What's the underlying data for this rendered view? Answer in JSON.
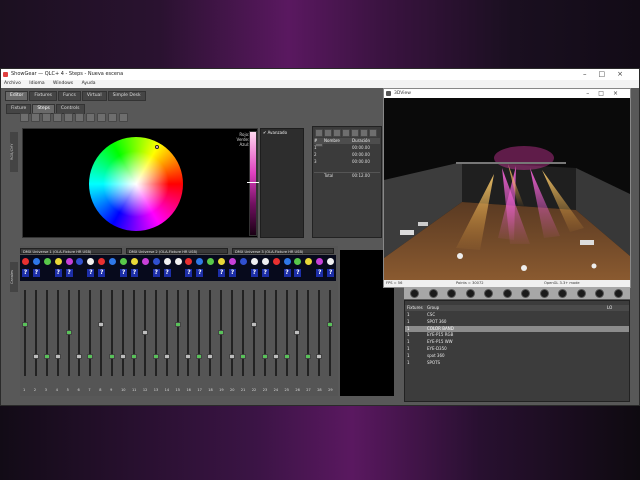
{
  "window": {
    "title": "ShowGear — QLC+ 4 - Steps - Nueva escena"
  },
  "menu": [
    "Archivo",
    "Idioma",
    "Windows",
    "Ayuda"
  ],
  "main_tabs": [
    "Editor",
    "Fixtures",
    "Funcs",
    "Virtual",
    "Simple Desk"
  ],
  "sub_tabs": [
    "Fixture",
    "Steps",
    "Controls"
  ],
  "color_picker": {
    "r": "Rojo:000",
    "g": "Verde:000",
    "b": "Azul:000"
  },
  "fx_panel": {
    "item": "✔ Avanzado"
  },
  "side_labels": {
    "top": "RGB/CMY",
    "mixer": "Canales"
  },
  "steps": {
    "headers": [
      "#",
      "Nombre",
      "Duración"
    ],
    "rows": [
      [
        "1",
        "",
        "00:00.00"
      ],
      [
        "2",
        "",
        "00:00.00"
      ],
      [
        "3",
        "",
        "00:00.00"
      ]
    ],
    "total": [
      "",
      "Total",
      "00:12.00"
    ]
  },
  "universes": [
    "DMX Universe 1 (OLA-Fixture HR USB)",
    "DMX Universe 2 (OLA-Fixture HR USB)",
    "DMX Universe 3 (OLA-Fixture HR USB)"
  ],
  "channel_numbers": [
    "1",
    "2",
    "3",
    "4",
    "5",
    "6",
    "7",
    "8",
    "9",
    "10",
    "11",
    "12",
    "13",
    "14",
    "15",
    "16",
    "17",
    "18",
    "19",
    "20",
    "21",
    "22",
    "23",
    "24",
    "25",
    "26",
    "27",
    "28",
    "29"
  ],
  "dot_colors": [
    "#e83030",
    "#2f78e8",
    "#58c84a",
    "#e8d838",
    "#c840d8",
    "#3050d0",
    "#f0f0f0",
    "#e83030",
    "#2f78e8",
    "#58c84a",
    "#e8d838",
    "#c840d8",
    "#3050d0",
    "#f0f0f0",
    "#f0f0f0",
    "#e83030",
    "#2f78e8",
    "#58c84a",
    "#e8d838",
    "#c840d8",
    "#3050d0",
    "#f0f0f0",
    "#f0f0f0",
    "#e83030",
    "#2f78e8",
    "#58c84a",
    "#e8d838",
    "#c840d8",
    "#f0f0f0"
  ],
  "view3d": {
    "title": "3DView",
    "fps": "FPS = 56",
    "points": "Points = 30072",
    "renderer": "OpenGL 3.3+ mode"
  },
  "groups": {
    "headers": [
      "Fixtures",
      "Group",
      "LO"
    ],
    "rows": [
      [
        "1",
        "CSC"
      ],
      [
        "1",
        "SPOT 360"
      ],
      [
        "1",
        "COLOR BAND"
      ],
      [
        "1",
        "EYE-P15 RGB"
      ],
      [
        "1",
        "EYE-P15 WW"
      ],
      [
        "1",
        "EYE-D350"
      ],
      [
        "1",
        "spot 360"
      ],
      [
        "1",
        "SPOTS"
      ]
    ],
    "selected_index": 2
  },
  "colors": {
    "accent": "#d84ad0",
    "selection": "#8c8c8c"
  }
}
